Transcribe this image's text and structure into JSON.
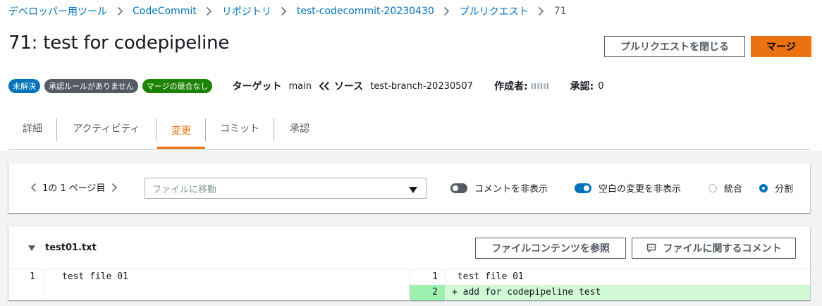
{
  "breadcrumb": {
    "items": [
      "デベロッパー用ツール",
      "CodeCommit",
      "リポジトリ",
      "test-codecommit-20230430",
      "プルリクエスト"
    ],
    "current": "71"
  },
  "title": "71: test for codepipeline",
  "buttons": {
    "close": "プルリクエストを閉じる",
    "merge": "マージ"
  },
  "badges": {
    "status": "未解決",
    "rules": "承認ルールがありません",
    "conflict": "マージの競合なし"
  },
  "meta": {
    "target_label": "ターゲット",
    "target_value": "main",
    "source_label": "ソース",
    "source_value": "test-branch-20230507",
    "author_label": "作成者:",
    "approval_label": "承認:",
    "approval_value": "0"
  },
  "tabs": [
    {
      "label": "詳細",
      "active": false
    },
    {
      "label": "アクティビティ",
      "active": false
    },
    {
      "label": "変更",
      "active": true
    },
    {
      "label": "コミット",
      "active": false
    },
    {
      "label": "承認",
      "active": false
    }
  ],
  "toolbar": {
    "pager": "1の 1 ページ目",
    "file_select_placeholder": "ファイルに移動",
    "hide_comments_label": "コメントを非表示",
    "hide_comments_on": false,
    "hide_whitespace_label": "空白の変更を非表示",
    "hide_whitespace_on": true,
    "unified_label": "統合",
    "split_label": "分割",
    "view_mode": "split"
  },
  "file": {
    "name": "test01.txt",
    "browse_button": "ファイルコンテンツを参照",
    "comment_button": "ファイルに関するコメント",
    "left": [
      {
        "num": "1",
        "text": "test file 01"
      }
    ],
    "right": [
      {
        "num": "1",
        "text": " test file 01",
        "added": false
      },
      {
        "num": "2",
        "text": "+ add for codepipeline test",
        "added": true
      }
    ]
  },
  "colors": {
    "link": "#0073bb",
    "accent": "#ec7211",
    "badge_blue": "#0073bb",
    "badge_grey": "#545b64",
    "badge_green": "#1d8102",
    "added_line_bg": "#d2f9d6",
    "added_num_bg": "#9ef0b0"
  },
  "icons": {
    "separator": "chevron-right-icon",
    "source_arrow": "double-chevron-left-icon",
    "pager_prev": "chevron-left-icon",
    "pager_next": "chevron-right-icon",
    "select_caret": "caret-down-icon",
    "file_collapse": "caret-down-icon",
    "comment": "comment-icon"
  }
}
